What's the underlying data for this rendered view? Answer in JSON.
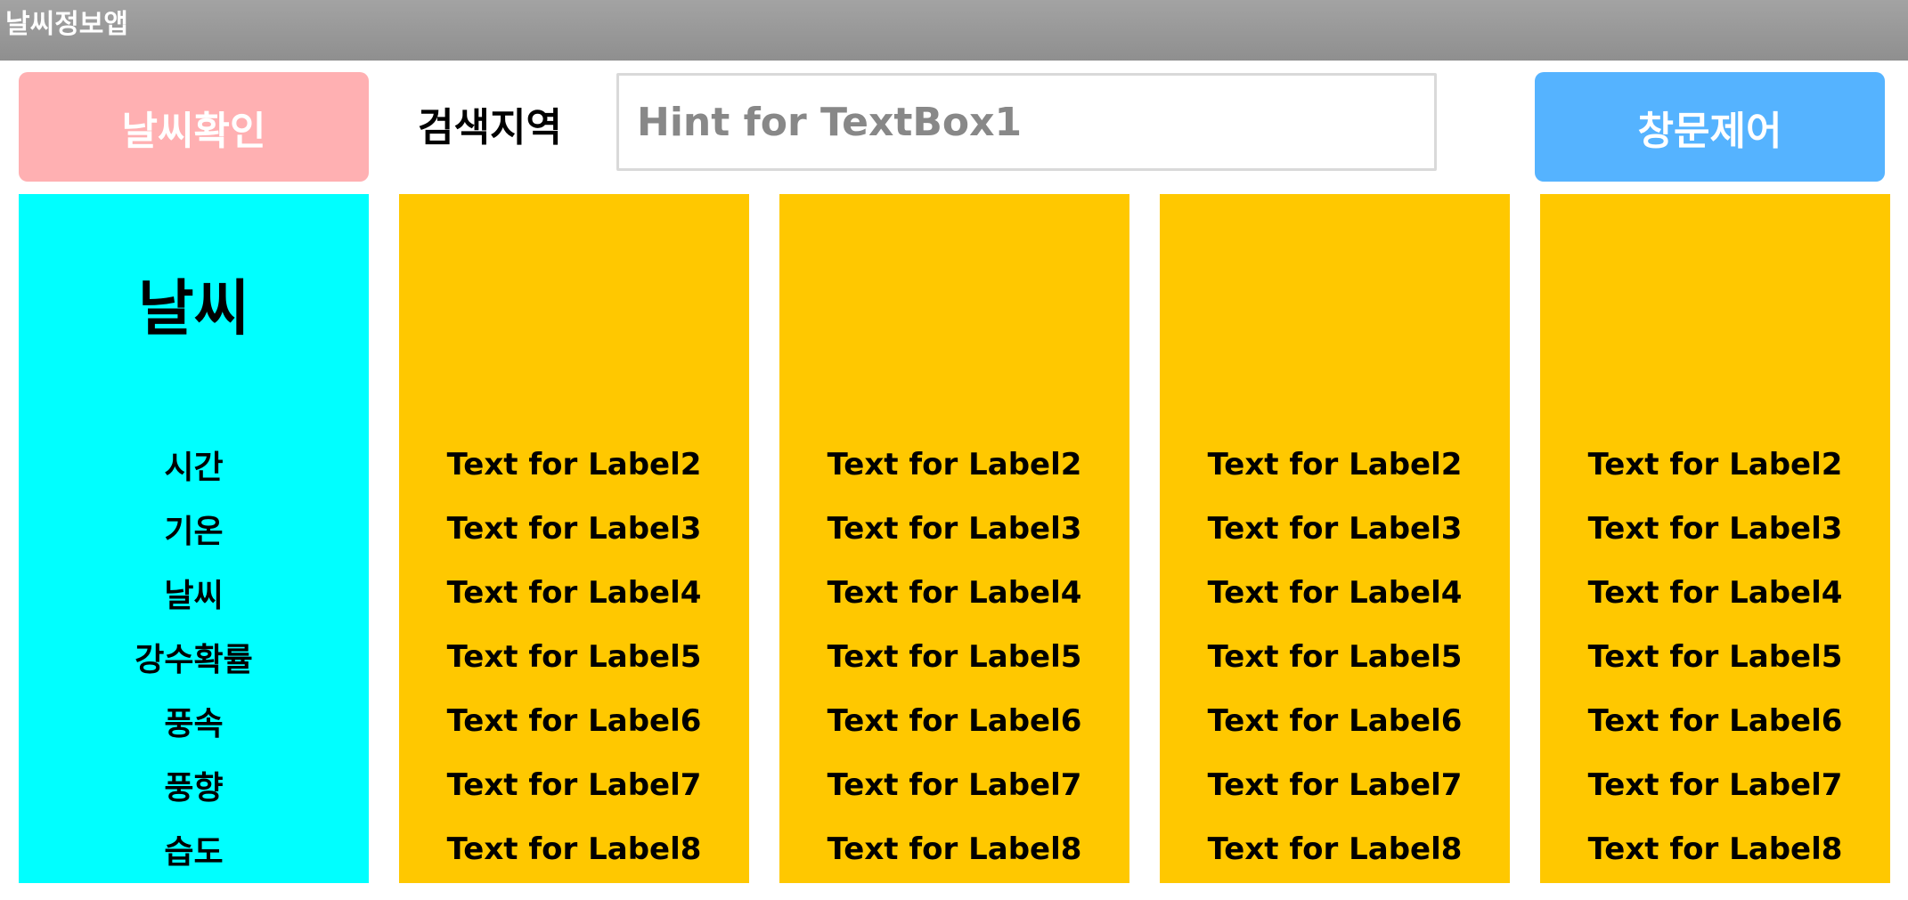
{
  "app": {
    "title": "날씨정보앱"
  },
  "colors": {
    "titlebar": "#8f8f8f",
    "weather_button_bg": "#ffb0b2",
    "window_button_bg": "#55b3ff",
    "label_column_bg": "#00ffff",
    "data_column_bg": "#ffc800"
  },
  "toolbar": {
    "weather_button_label": "날씨확인",
    "search_label": "검색지역",
    "search_placeholder": "Hint for TextBox1",
    "search_value": "",
    "window_button_label": "창문제어"
  },
  "labels_column": {
    "heading": "날씨",
    "rows": [
      "시간",
      "기온",
      "날씨",
      "강수확률",
      "풍속",
      "풍향",
      "습도"
    ]
  },
  "data_columns": [
    {
      "rows": [
        "Text for Label2",
        "Text for Label3",
        "Text for Label4",
        "Text for Label5",
        "Text for Label6",
        "Text for Label7",
        "Text for Label8"
      ]
    },
    {
      "rows": [
        "Text for Label2",
        "Text for Label3",
        "Text for Label4",
        "Text for Label5",
        "Text for Label6",
        "Text for Label7",
        "Text for Label8"
      ]
    },
    {
      "rows": [
        "Text for Label2",
        "Text for Label3",
        "Text for Label4",
        "Text for Label5",
        "Text for Label6",
        "Text for Label7",
        "Text for Label8"
      ]
    },
    {
      "rows": [
        "Text for Label2",
        "Text for Label3",
        "Text for Label4",
        "Text for Label5",
        "Text for Label6",
        "Text for Label7",
        "Text for Label8"
      ]
    }
  ]
}
